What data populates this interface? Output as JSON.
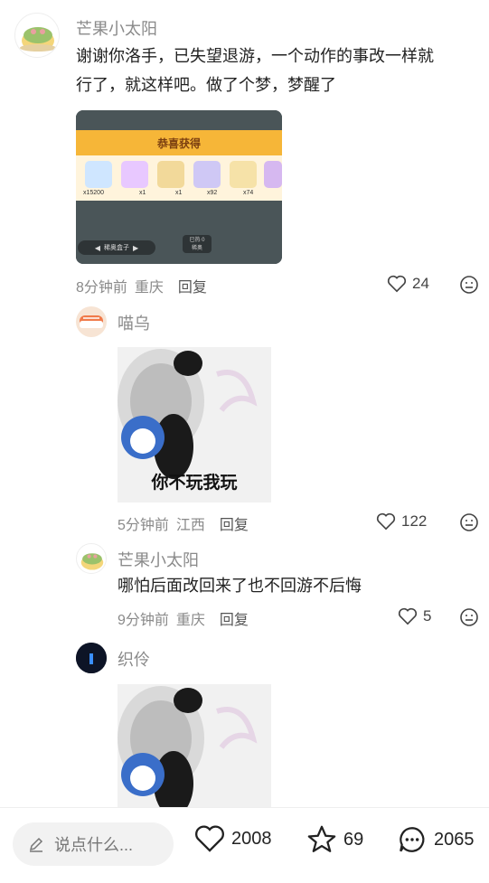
{
  "comments": [
    {
      "username": "芒果小太阳",
      "text_line1": "谢谢你洛手，已失望退游，一个动作的事改一样就",
      "text_line2": "行了，就这样吧。做了个梦，梦醒了",
      "time": "8分钟前",
      "location": "重庆",
      "reply_label": "回复",
      "likes": "24",
      "image": {
        "banner_title": "恭喜获得",
        "items": [
          "x15200",
          "x1",
          "x1",
          "x92",
          "x74"
        ],
        "button_label": "稀奥盒子",
        "tag_label": "已热 0",
        "tag_sub": "稀奥"
      }
    },
    {
      "username": "喵乌",
      "caption": "你不玩我玩",
      "time": "5分钟前",
      "location": "江西",
      "reply_label": "回复",
      "likes": "122"
    },
    {
      "username": "芒果小太阳",
      "text": "哪怕后面改回来了也不回游不后悔",
      "time": "9分钟前",
      "location": "重庆",
      "reply_label": "回复",
      "likes": "5"
    },
    {
      "username": "织伶"
    }
  ],
  "bottom_bar": {
    "input_placeholder": "说点什么...",
    "likes": "2008",
    "favorites": "69",
    "comments": "2065"
  },
  "colors": {
    "accent_orange": "#f6b638",
    "muted": "#8a8a8a"
  }
}
